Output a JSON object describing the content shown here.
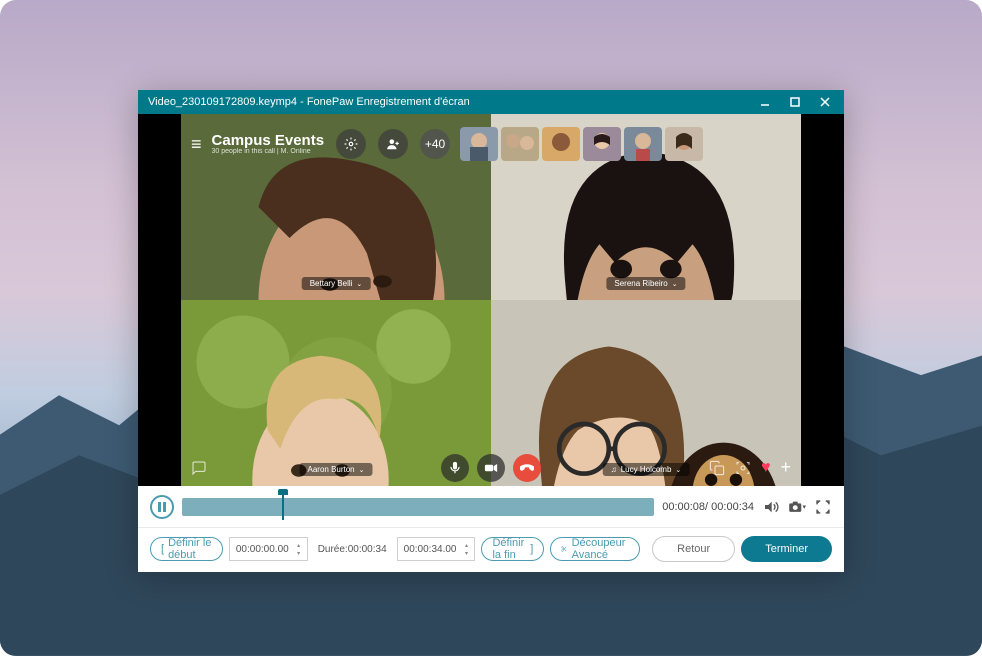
{
  "titlebar": {
    "filename": "Video_230109172809.keymp4",
    "separator": "  -  ",
    "appname": "FonePaw Enregistrement d'écran"
  },
  "videocall": {
    "channel_title": "Campus Events",
    "channel_subtitle": "30 people in this call | M. Online",
    "overflow_count": "+40",
    "participants": [
      {
        "name": "Bettary Belli"
      },
      {
        "name": "Serena Ribeiro"
      },
      {
        "name": "Aaron Burton"
      },
      {
        "name": "Lucy Holcomb"
      }
    ]
  },
  "playback": {
    "current_time": "00:00:08",
    "total_time": "00:00:34",
    "time_sep": "/ "
  },
  "trim": {
    "set_start_label": "Définir le début",
    "start_time": "00:00:00.00",
    "duration_prefix": "Durée:",
    "duration_value": "00:00:34",
    "end_time": "00:00:34.00",
    "set_end_label": "Définir la fin",
    "advanced_cutter": "Découpeur Avancé",
    "back_label": "Retour",
    "finish_label": "Terminer"
  }
}
